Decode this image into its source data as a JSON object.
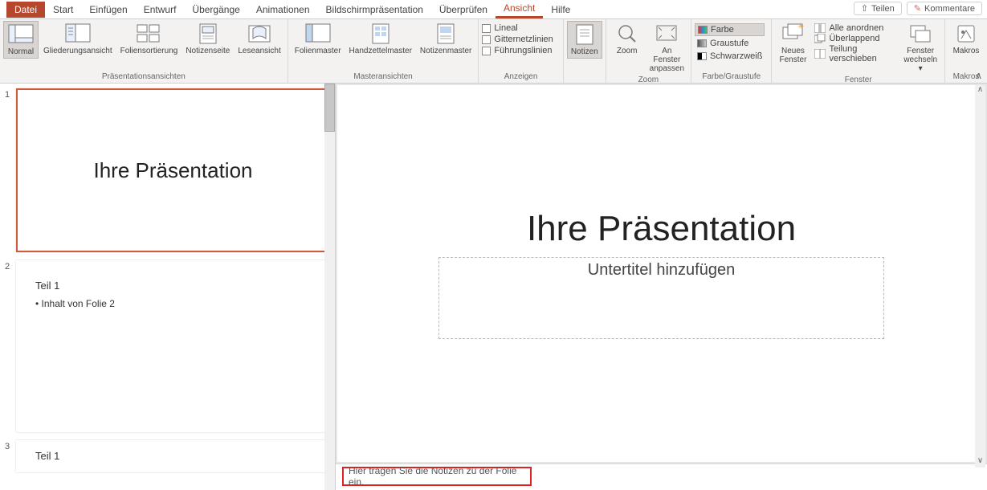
{
  "tabs": {
    "file": "Datei",
    "items": [
      "Start",
      "Einfügen",
      "Entwurf",
      "Übergänge",
      "Animationen",
      "Bildschirmpräsentation",
      "Überprüfen",
      "Ansicht",
      "Hilfe"
    ],
    "active": "Ansicht",
    "share": "Teilen",
    "comments": "Kommentare"
  },
  "ribbon": {
    "g_pres": {
      "label": "Präsentationsansichten",
      "normal": "Normal",
      "outline": "Gliederungsansicht",
      "sorter": "Foliensortierung",
      "notespage": "Notizenseite",
      "reading": "Leseansicht"
    },
    "g_master": {
      "label": "Masteransichten",
      "slide": "Folienmaster",
      "handout": "Handzettelmaster",
      "notes": "Notizenmaster"
    },
    "g_show": {
      "label": "Anzeigen",
      "ruler": "Lineal",
      "grid": "Gitternetzlinien",
      "guides": "Führungslinien"
    },
    "g_notes": {
      "notes": "Notizen"
    },
    "g_zoom": {
      "label": "Zoom",
      "zoom": "Zoom",
      "fit1": "An Fenster",
      "fit2": "anpassen"
    },
    "g_color": {
      "label": "Farbe/Graustufe",
      "color": "Farbe",
      "gray": "Graustufe",
      "bw": "Schwarzweiß"
    },
    "g_window": {
      "label": "Fenster",
      "new1": "Neues",
      "new2": "Fenster",
      "arrange": "Alle anordnen",
      "overlap": "Überlappend",
      "split": "Teilung verschieben",
      "switch1": "Fenster",
      "switch2": "wechseln"
    },
    "g_macros": {
      "label": "Makros",
      "macros": "Makros"
    }
  },
  "thumbs": {
    "n1": "1",
    "n2": "2",
    "n3": "3",
    "s1_title": "Ihre Präsentation",
    "s2_title": "Teil 1",
    "s2_body": "• Inhalt von Folie 2",
    "s3_title": "Teil 1"
  },
  "slide": {
    "title": "Ihre Präsentation",
    "subtitle_ph": "Untertitel hinzufügen"
  },
  "notes": {
    "placeholder": "Hier tragen Sie die Notizen zu der Folie ein."
  }
}
